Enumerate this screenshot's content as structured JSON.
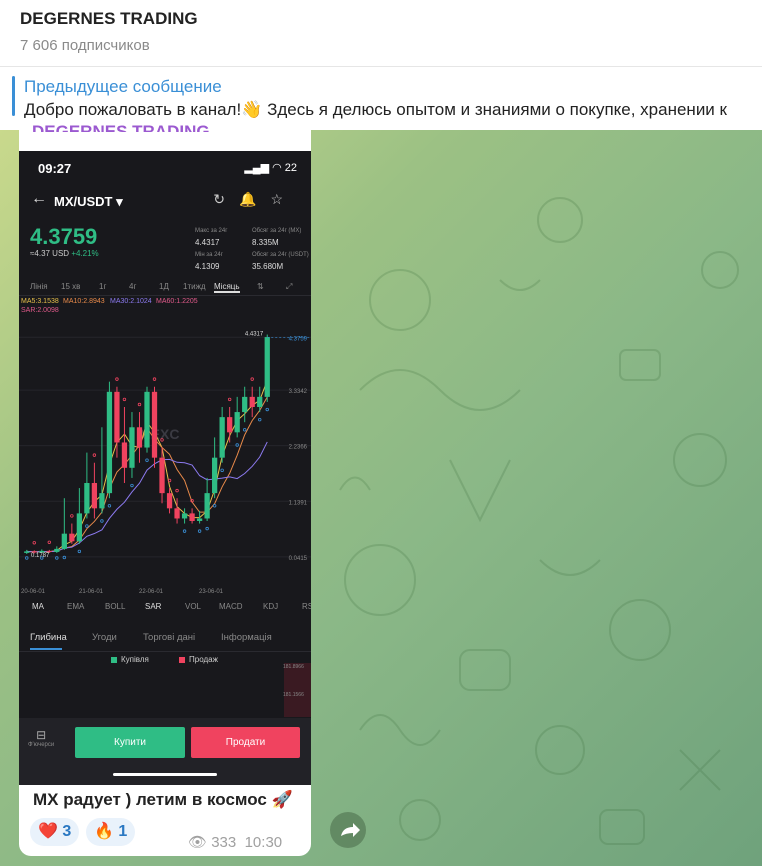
{
  "channel": {
    "title": "DEGERNES TRADING",
    "subscribers": "7 606 подписчиков"
  },
  "pinned": {
    "title": "Предыдущее сообщение",
    "text": "Добро пожаловать в канал!👋 Здесь я делюсь опытом и знаниями о покупке, хранении к"
  },
  "post": {
    "sender": "DEGERNES TRADING",
    "caption": "MX радует ) летим в космос 🚀",
    "reactions": [
      {
        "emoji": "❤️",
        "count": "3"
      },
      {
        "emoji": "🔥",
        "count": "1"
      }
    ],
    "views": "333",
    "time": "10:30"
  },
  "screenshot": {
    "time": "09:27",
    "battery": "22",
    "pair": "MX/USDT",
    "price": "4.3759",
    "sub_price": "≈4.37 USD",
    "change": "+4.21%",
    "stats": [
      {
        "label": "Макс за 24г",
        "value": "4.4317"
      },
      {
        "label": "Обсяг за 24г (MX)",
        "value": "8.335M"
      },
      {
        "label": "Мін за 24г",
        "value": "4.1309"
      },
      {
        "label": "Обсяг за 24г (USDT)",
        "value": "35.680M"
      }
    ],
    "timeframes": [
      "Лінія",
      "15 хв",
      "1г",
      "4г",
      "1Д",
      "1тижд",
      "Місяць"
    ],
    "active_timeframe": "Місяць",
    "ma": {
      "ma5": "MA5:3.1538",
      "ma10": "MA10:2.8943",
      "ma30": "MA30:2.1024",
      "ma60": "MA60:1.2205",
      "sar": "SAR:2.0098"
    },
    "chart_data": {
      "type": "candlestick",
      "y_ticks": [
        "4.3759",
        "3.3342",
        "2.2366",
        "1.1391",
        "0.0415"
      ],
      "x_ticks": [
        "20-06-01",
        "21-06-01",
        "22-06-01",
        "23-06-01"
      ],
      "high_label": "4.4317",
      "low_label": "0.1787",
      "watermark": "MEXC",
      "candles": [
        {
          "o": 0.12,
          "c": 0.15,
          "h": 0.18,
          "l": 0.1
        },
        {
          "o": 0.15,
          "c": 0.13,
          "h": 0.17,
          "l": 0.11
        },
        {
          "o": 0.13,
          "c": 0.16,
          "h": 0.19,
          "l": 0.12
        },
        {
          "o": 0.16,
          "c": 0.14,
          "h": 0.18,
          "l": 0.12
        },
        {
          "o": 0.14,
          "c": 0.2,
          "h": 0.25,
          "l": 0.12
        },
        {
          "o": 0.2,
          "c": 0.5,
          "h": 1.2,
          "l": 0.18
        },
        {
          "o": 0.5,
          "c": 0.35,
          "h": 0.7,
          "l": 0.3
        },
        {
          "o": 0.35,
          "c": 0.9,
          "h": 1.4,
          "l": 0.3
        },
        {
          "o": 0.9,
          "c": 1.5,
          "h": 2.1,
          "l": 0.8
        },
        {
          "o": 1.5,
          "c": 1.0,
          "h": 1.9,
          "l": 0.8
        },
        {
          "o": 1.0,
          "c": 1.3,
          "h": 2.6,
          "l": 0.9
        },
        {
          "o": 1.3,
          "c": 3.3,
          "h": 3.5,
          "l": 1.2
        },
        {
          "o": 3.3,
          "c": 2.3,
          "h": 3.4,
          "l": 2.0
        },
        {
          "o": 2.3,
          "c": 1.8,
          "h": 3.0,
          "l": 1.5
        },
        {
          "o": 1.8,
          "c": 2.6,
          "h": 2.9,
          "l": 1.6
        },
        {
          "o": 2.6,
          "c": 2.2,
          "h": 2.9,
          "l": 1.9
        },
        {
          "o": 2.2,
          "c": 3.3,
          "h": 3.4,
          "l": 2.1
        },
        {
          "o": 3.3,
          "c": 2.0,
          "h": 3.4,
          "l": 1.8
        },
        {
          "o": 2.0,
          "c": 1.3,
          "h": 2.2,
          "l": 1.1
        },
        {
          "o": 1.3,
          "c": 1.0,
          "h": 1.4,
          "l": 0.9
        },
        {
          "o": 1.0,
          "c": 0.8,
          "h": 1.2,
          "l": 0.7
        },
        {
          "o": 0.8,
          "c": 0.9,
          "h": 1.0,
          "l": 0.7
        },
        {
          "o": 0.9,
          "c": 0.75,
          "h": 1.0,
          "l": 0.7
        },
        {
          "o": 0.75,
          "c": 0.8,
          "h": 0.95,
          "l": 0.7
        },
        {
          "o": 0.8,
          "c": 1.3,
          "h": 1.6,
          "l": 0.75
        },
        {
          "o": 1.3,
          "c": 2.0,
          "h": 2.4,
          "l": 1.2
        },
        {
          "o": 2.0,
          "c": 2.8,
          "h": 3.0,
          "l": 1.9
        },
        {
          "o": 2.8,
          "c": 2.5,
          "h": 3.0,
          "l": 2.3
        },
        {
          "o": 2.5,
          "c": 2.9,
          "h": 3.2,
          "l": 2.4
        },
        {
          "o": 2.9,
          "c": 3.2,
          "h": 3.4,
          "l": 2.7
        },
        {
          "o": 3.2,
          "c": 3.0,
          "h": 3.4,
          "l": 2.8
        },
        {
          "o": 3.0,
          "c": 3.2,
          "h": 3.4,
          "l": 2.9
        },
        {
          "o": 3.2,
          "c": 4.38,
          "h": 4.43,
          "l": 3.1
        }
      ]
    },
    "indicators": [
      "MA",
      "EMA",
      "BOLL",
      "SAR",
      "VOL",
      "MACD",
      "KDJ",
      "RS"
    ],
    "active_indicators": [
      "MA",
      "SAR"
    ],
    "tabs": [
      "Глибина",
      "Угоди",
      "Торгові дані",
      "Інформація"
    ],
    "active_tab": "Глибина",
    "legend": {
      "buy": "Купівля",
      "sell": "Продаж"
    },
    "depth_labels": [
      "181.8966",
      "181.1566"
    ],
    "futures_label": "Ф'ючерси",
    "buy_button": "Купити",
    "sell_button": "Продати",
    "colors": {
      "up": "#2fbd85",
      "down": "#f0435f"
    }
  }
}
